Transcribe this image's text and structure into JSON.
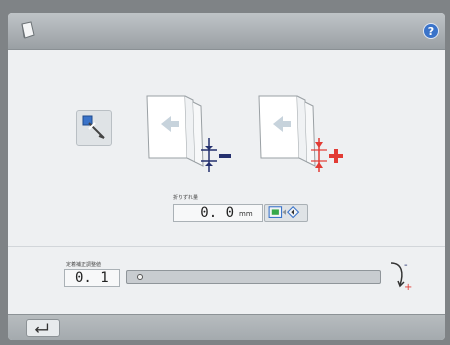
{
  "header": {
    "doc_icon": "document-icon",
    "help_label": "?",
    "help_icon": "help-icon"
  },
  "main": {
    "mode_icon": "pencil-pointer-icon",
    "misalignment_label": "折りずれ量",
    "misalignment_value": "0. 0",
    "misalignment_unit": "mm",
    "adjust_icon": "book-arrow-icon",
    "correction_label": "定着補正調整値",
    "correction_value": "0. 1",
    "curl_minus": "-",
    "curl_plus": "+",
    "slider_level": 0.02
  },
  "footer": {
    "back_icon": "return-arrow-icon"
  },
  "colors": {
    "accent_blue": "#3a73c9",
    "minus_navy": "#24306e",
    "plus_red": "#e23b34"
  }
}
